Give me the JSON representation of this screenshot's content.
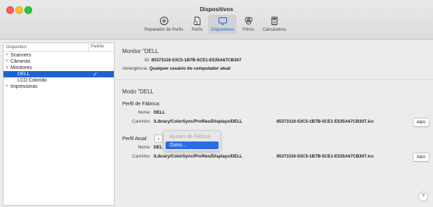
{
  "window": {
    "title": "Dispositivos"
  },
  "toolbar": {
    "items": [
      {
        "label": "Reparador de Perfis",
        "icon": "plus-circle-icon"
      },
      {
        "label": "Perfis",
        "icon": "profile-doc-icon"
      },
      {
        "label": "Dispositivos",
        "icon": "monitor-icon",
        "active": true
      },
      {
        "label": "Filtros",
        "icon": "filters-icon"
      },
      {
        "label": "Calculadora",
        "icon": "calculator-icon"
      }
    ]
  },
  "sidebar": {
    "col_device": "Dispositivo",
    "col_default": "Padrão",
    "items": [
      {
        "label": "Scanners",
        "arrow": ">"
      },
      {
        "label": "Câmeras",
        "arrow": ">"
      },
      {
        "label": "Monitores",
        "arrow": "∨"
      },
      {
        "label": "DELL",
        "child": true,
        "selected": true,
        "check": "✓"
      },
      {
        "label": "LCD Colorido",
        "child": true
      },
      {
        "label": "Impressoras",
        "arrow": ">"
      }
    ]
  },
  "monitor": {
    "title": "Monitor \"DELL",
    "id_label": "ID:",
    "id_value": "85373116-53C5-1B7B-5CE1-E535A67CB307",
    "scope_label": "Abrangência:",
    "scope_value": "Qualquer usuário do computador atual"
  },
  "mode": {
    "title": "Modo \"DELL",
    "factory_section": "Perfil de Fábrica:",
    "name_label": "Nome:",
    "factory_name": "DELL",
    "path_label": "Caminho:",
    "factory_path": "/Library/ColorSync/Profiles/Displays/DELL",
    "factory_file": "85373116-53C5-1B7B-5CE1-E535A67CB307.icc",
    "open_label": "Abrir",
    "current_section": "Perfil Atual:",
    "current_name": "DEL",
    "current_path": "/Library/ColorSync/Profiles/Displays/DELL",
    "current_file": "85373116-53C5-1B7B-5CE1-E535A67CB307.icc",
    "popup_arrow": "⌄"
  },
  "menu": {
    "items": [
      "Ajustes de Fábrica",
      "Outro..."
    ]
  },
  "help": "?"
}
